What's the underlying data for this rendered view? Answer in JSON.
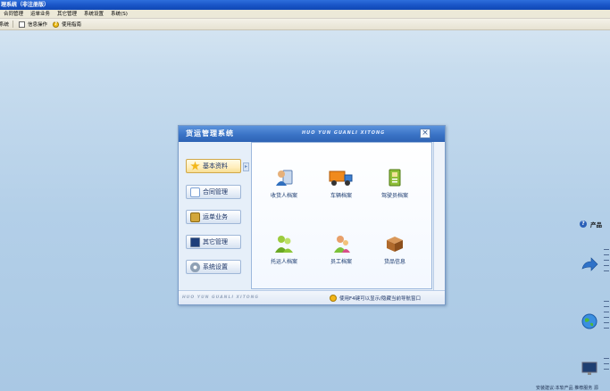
{
  "window": {
    "title": "理系统（非注册版）"
  },
  "menu": {
    "items": [
      "合同管理",
      "运单业务",
      "其它管理",
      "系统设置",
      "系统(S)"
    ]
  },
  "toolbar": {
    "items": [
      {
        "label": "系统",
        "icon": "grid-icon"
      },
      {
        "label": "信息操作",
        "icon": "box-icon"
      },
      {
        "label": "使用指南",
        "icon": "help-icon"
      }
    ]
  },
  "dialog": {
    "title": "货运管理系统",
    "subtitle": "HUO YUN GUANLI XITONG",
    "close_label": "×",
    "nav": [
      {
        "label": "基本资料",
        "icon": "star-icon",
        "color": "#f2b619"
      },
      {
        "label": "合同管理",
        "icon": "book-icon",
        "color": "#7da2d6"
      },
      {
        "label": "运单业务",
        "icon": "document-icon",
        "color": "#d2a63a"
      },
      {
        "label": "其它管理",
        "icon": "monitor-icon",
        "color": "#3a6fb8"
      },
      {
        "label": "系统设置",
        "icon": "gear-icon",
        "color": "#8ea0b4"
      }
    ],
    "nav_arrow": "▸",
    "tiles": [
      {
        "label": "收货人档案",
        "icon": "consignee-icon"
      },
      {
        "label": "车辆档案",
        "icon": "truck-icon"
      },
      {
        "label": "驾驶员档案",
        "icon": "driver-icon"
      },
      {
        "label": "托运人档案",
        "icon": "shipper-icon"
      },
      {
        "label": "员工档案",
        "icon": "employee-icon"
      },
      {
        "label": "货品信息",
        "icon": "cargo-box-icon"
      }
    ],
    "footer_brand": "HUO YUN GUANLI XITONG",
    "footer_hint": "使用F4键可以显示/隐藏当前导航窗口"
  },
  "side_panel": {
    "title": "产品"
  },
  "bottom_text": "安装建议:本软产品  推荐服务  源"
}
